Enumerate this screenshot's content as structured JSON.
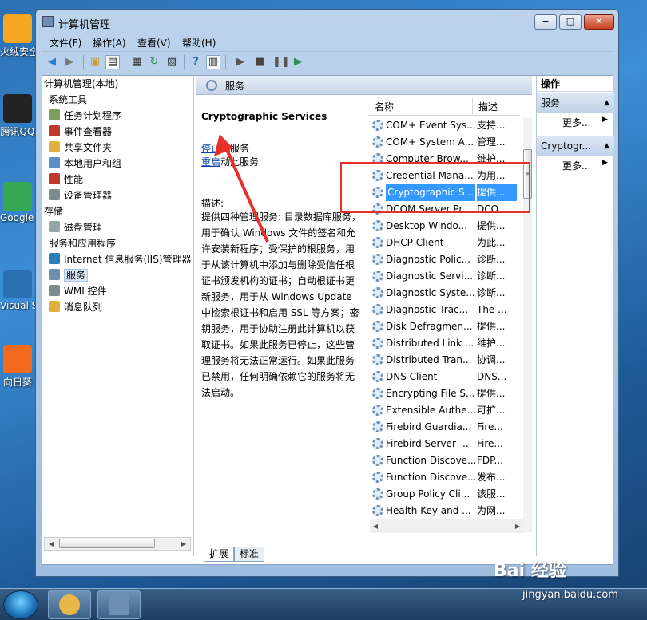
{
  "desktop_icons": [
    {
      "label": "火绒安全",
      "icon": "huorong-shield-icon",
      "color": "#f5a623"
    },
    {
      "label": "腾讯QQ",
      "icon": "qq-penguin-icon",
      "color": "#222222"
    },
    {
      "label": "Google Chrome",
      "icon": "chrome-icon",
      "color": "#34a853"
    },
    {
      "label": "Visual Studio",
      "icon": "visual-studio-icon",
      "color": "#2b6fb3"
    },
    {
      "label": "向日葵",
      "icon": "sunflower-icon",
      "color": "#f26b1d"
    }
  ],
  "window": {
    "title": "计算机管理",
    "minimize": "−",
    "maximize": "□",
    "close": "✕"
  },
  "menu": [
    "文件(F)",
    "操作(A)",
    "查看(V)",
    "帮助(H)"
  ],
  "tree": [
    {
      "label": "计算机管理(本地)",
      "icon": "computer-icon",
      "color": "#6e8fb4"
    },
    {
      "label": "系统工具",
      "icon": "tools-icon",
      "color": "#8c8c8c"
    },
    {
      "label": "任务计划程序",
      "icon": "clock-icon",
      "color": "#7ba05b"
    },
    {
      "label": "事件查看器",
      "icon": "event-viewer-icon",
      "color": "#c0392b"
    },
    {
      "label": "共享文件夹",
      "icon": "shared-folder-icon",
      "color": "#e0b040"
    },
    {
      "label": "本地用户和组",
      "icon": "users-icon",
      "color": "#5c8fc9"
    },
    {
      "label": "性能",
      "icon": "performance-icon",
      "color": "#c0392b"
    },
    {
      "label": "设备管理器",
      "icon": "device-manager-icon",
      "color": "#7f8c8d"
    },
    {
      "label": "存储",
      "icon": "storage-icon",
      "color": "#8c8c8c"
    },
    {
      "label": "磁盘管理",
      "icon": "disk-icon",
      "color": "#95a5a6"
    },
    {
      "label": "服务和应用程序",
      "icon": "services-apps-icon",
      "color": "#8c8c8c"
    },
    {
      "label": "Internet 信息服务(IIS)管理器",
      "icon": "iis-icon",
      "color": "#2980b9"
    },
    {
      "label": "服务",
      "icon": "gear-icon",
      "color": "#6f8fb0"
    },
    {
      "label": "WMI 控件",
      "icon": "wmi-icon",
      "color": "#7f8c8d"
    },
    {
      "label": "消息队列",
      "icon": "message-queue-icon",
      "color": "#e0b040"
    }
  ],
  "services_header": "服务",
  "detail": {
    "title": "Cryptographic Services",
    "stop_link": "停止",
    "stop_rest": "此服务",
    "restart_link": "重启",
    "restart_rest": "动此服务",
    "desc_label": "描述:",
    "desc": "提供四种管理服务: 目录数据库服务，用于确认 Windows 文件的签名和允许安装新程序；受保护的根服务，用于从该计算机中添加与删除受信任根证书颁发机构的证书；自动根证书更新服务，用于从 Windows Update 中检索根证书和启用 SSL 等方案；密钥服务，用于协助注册此计算机以获取证书。如果此服务已停止，这些管理服务将无法正常运行。如果此服务已禁用，任何明确依赖它的服务将无法启动。"
  },
  "list": {
    "col_name": "名称",
    "col_desc": "描述",
    "rows": [
      {
        "name": "COM+ Event Sys...",
        "desc": "支持..."
      },
      {
        "name": "COM+ System A...",
        "desc": "管理..."
      },
      {
        "name": "Computer Brow...",
        "desc": "维护..."
      },
      {
        "name": "Credential Mana...",
        "desc": "为用..."
      },
      {
        "name": "Cryptographic S...",
        "desc": "提供...",
        "selected": true
      },
      {
        "name": "DCOM Server Pr...",
        "desc": "DCO..."
      },
      {
        "name": "Desktop Windo...",
        "desc": "提供..."
      },
      {
        "name": "DHCP Client",
        "desc": "为此..."
      },
      {
        "name": "Diagnostic Polic...",
        "desc": "诊断..."
      },
      {
        "name": "Diagnostic Servi...",
        "desc": "诊断..."
      },
      {
        "name": "Diagnostic Syste...",
        "desc": "诊断..."
      },
      {
        "name": "Diagnostic Trac...",
        "desc": "The ..."
      },
      {
        "name": "Disk Defragmen...",
        "desc": "提供..."
      },
      {
        "name": "Distributed Link ...",
        "desc": "维护..."
      },
      {
        "name": "Distributed Tran...",
        "desc": "协调..."
      },
      {
        "name": "DNS Client",
        "desc": "DNS..."
      },
      {
        "name": "Encrypting File S...",
        "desc": "提供..."
      },
      {
        "name": "Extensible Authe...",
        "desc": "可扩..."
      },
      {
        "name": "Firebird Guardia...",
        "desc": "Fire..."
      },
      {
        "name": "Firebird Server -...",
        "desc": "Fire..."
      },
      {
        "name": "Function Discove...",
        "desc": "FDP..."
      },
      {
        "name": "Function Discove...",
        "desc": "发布..."
      },
      {
        "name": "Group Policy Cli...",
        "desc": "该服..."
      },
      {
        "name": "Health Key and ...",
        "desc": "为网..."
      }
    ]
  },
  "tabs": [
    "扩展",
    "标准"
  ],
  "actions": {
    "header": "操作",
    "group1": "服务",
    "more1": "更多...",
    "group2": "Cryptogr...",
    "more2": "更多..."
  },
  "watermark": {
    "brand": "Bai 经验",
    "url": "jingyan.baidu.com"
  }
}
